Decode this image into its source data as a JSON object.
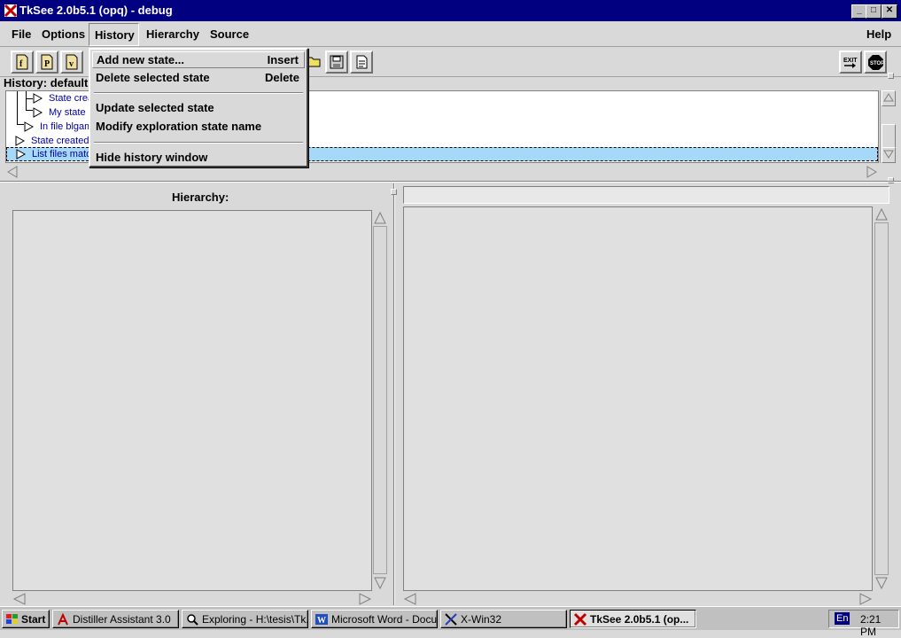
{
  "window": {
    "title": "TkSee 2.0b5.1 (opq) - debug",
    "minimize": "_",
    "maximize": "□",
    "close": "✕"
  },
  "menubar": {
    "file": "File",
    "options": "Options",
    "history": "History",
    "hierarchy": "Hierarchy",
    "source": "Source",
    "help": "Help"
  },
  "history_menu": {
    "items": [
      {
        "label": "Add new state...",
        "accel": "Insert"
      },
      {
        "label": "Delete selected state",
        "accel": "Delete"
      },
      {
        "label": "Update selected state",
        "accel": ""
      },
      {
        "label": "Modify exploration state name",
        "accel": ""
      },
      {
        "label": "Hide history window",
        "accel": ""
      }
    ]
  },
  "toolbar": {
    "icons": [
      "file-function-icon",
      "file-procedure-icon",
      "file-variable-icon",
      "open-folder-icon",
      "save-icon",
      "notes-icon",
      "exit-icon",
      "stop-icon"
    ],
    "exit_label": "EXIT",
    "stop_label": "STOP"
  },
  "history_panel": {
    "label": "History: default",
    "items": [
      {
        "text": "State crea"
      },
      {
        "text": "My state"
      },
      {
        "text": "In file blgam"
      },
      {
        "text": "State created"
      },
      {
        "text": "List files match"
      }
    ],
    "selected_index": 4
  },
  "hierarchy_panel": {
    "label": "Hierarchy:"
  },
  "source_panel": {
    "path_value": ""
  },
  "taskbar": {
    "start": "Start",
    "tasks": [
      {
        "label": "Distiller Assistant 3.0"
      },
      {
        "label": "Exploring - H:\\tesis\\Tk..."
      },
      {
        "label": "Microsoft Word - Docu..."
      },
      {
        "label": "X-Win32"
      },
      {
        "label": "TkSee 2.0b5.1 (op..."
      }
    ],
    "lang": "En",
    "clock": "2:21 PM"
  },
  "colors": {
    "titlebar": "#000080",
    "selection": "#a6d8f8",
    "link_text": "#0000a0"
  }
}
